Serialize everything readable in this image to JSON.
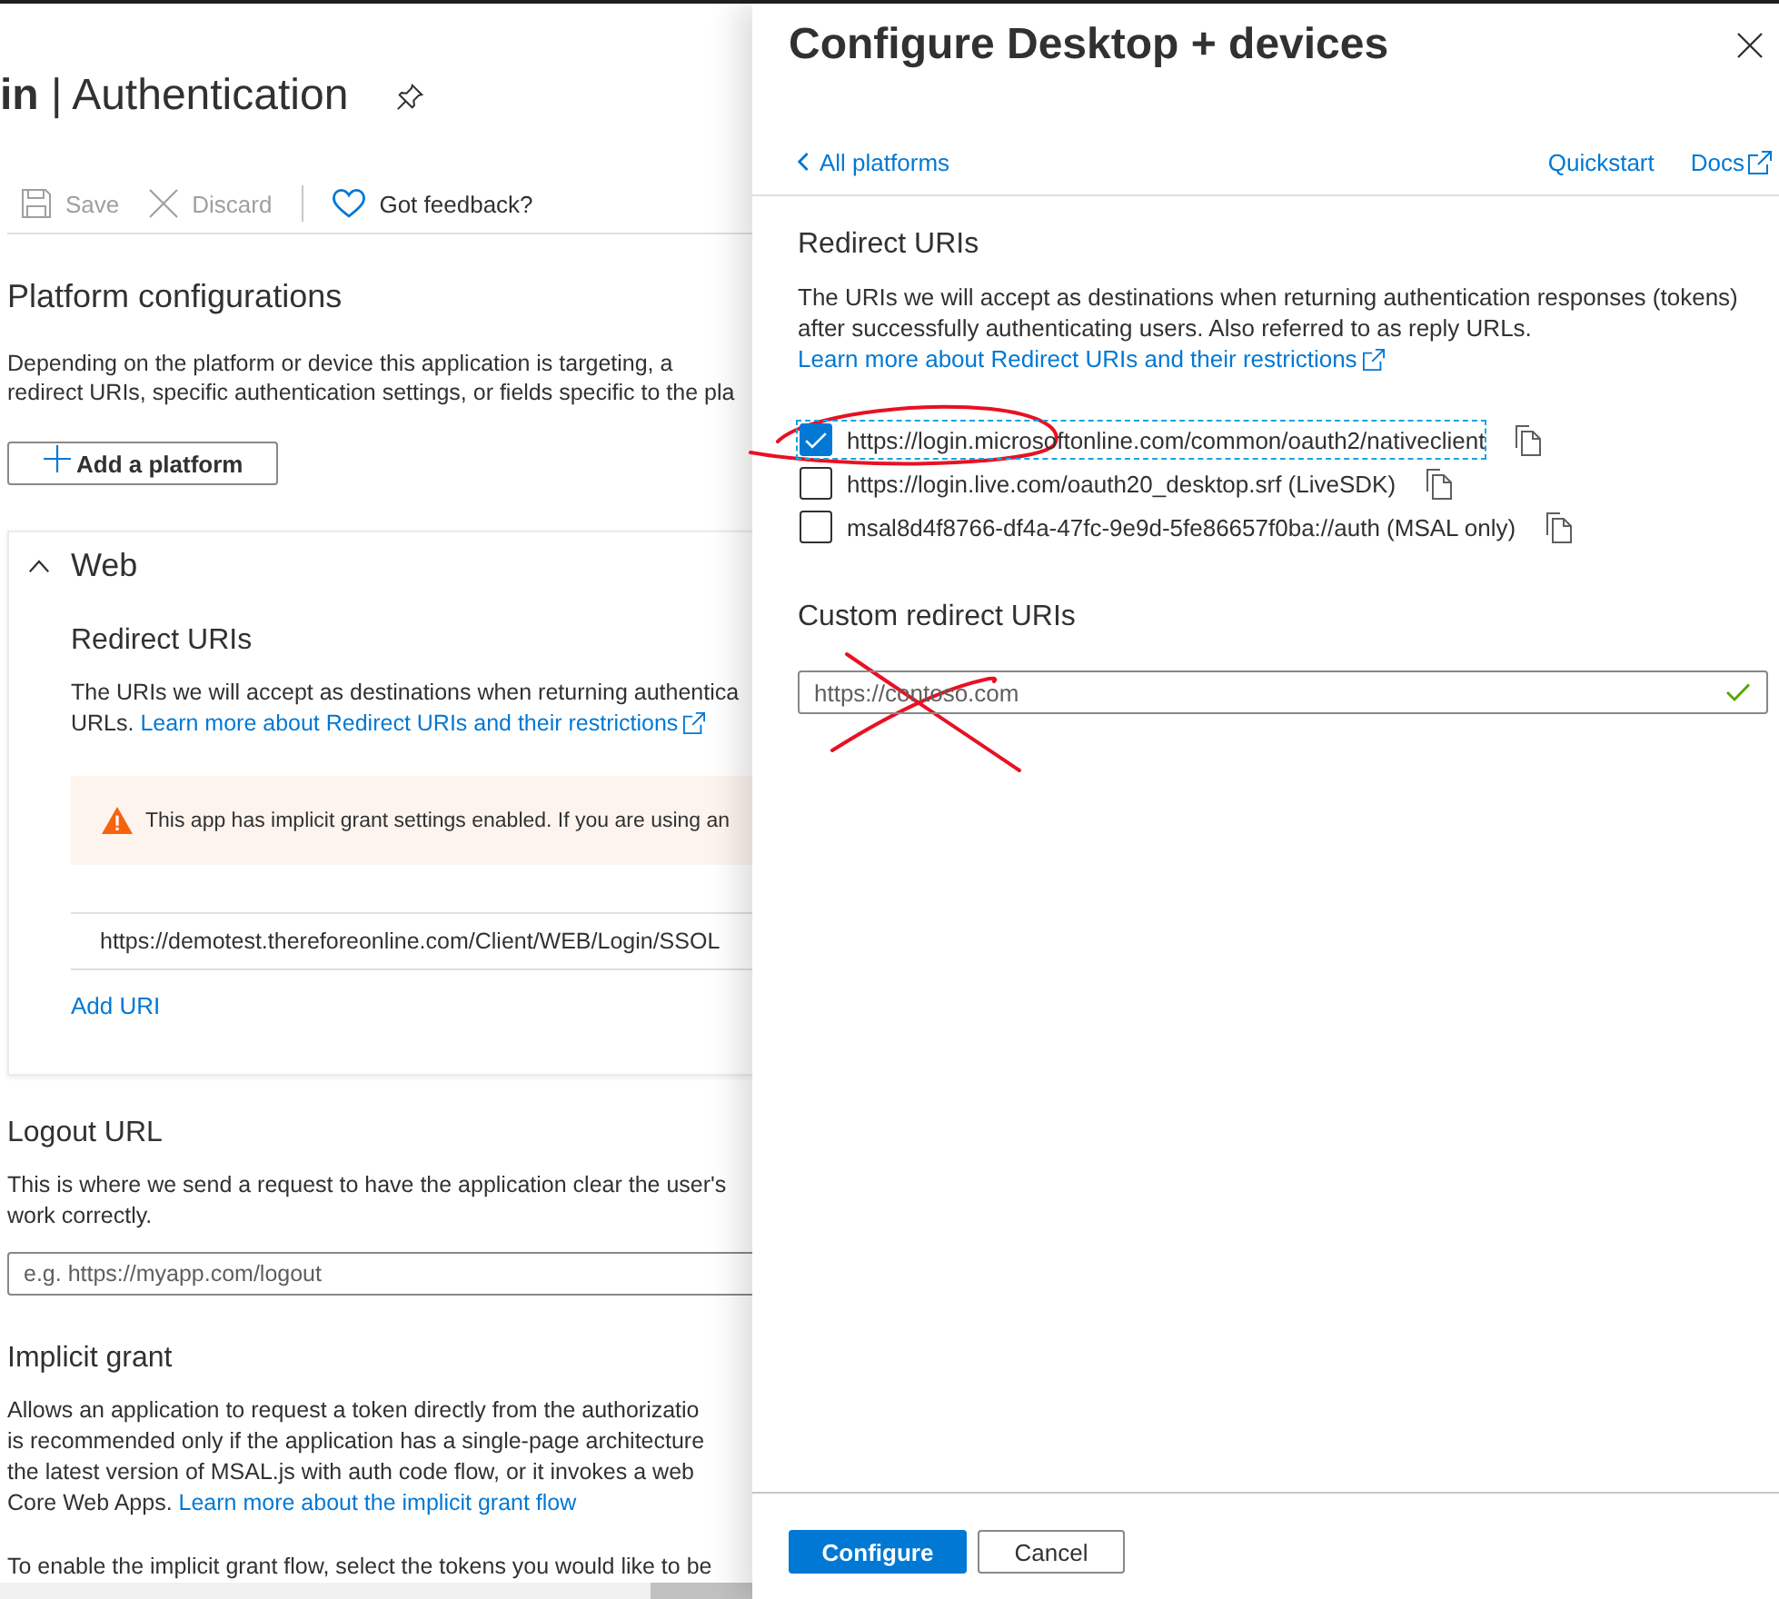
{
  "page": {
    "title": "**in** | Authentication",
    "toolbar": {
      "save": {
        "label": "Save",
        "disabled": true
      },
      "discard": {
        "label": "Discard",
        "disabled": true
      },
      "feedback": {
        "label": "Got feedback?",
        "disabled": false
      }
    },
    "platforms": {
      "heading": "Platform configurations",
      "lines": [
        "Depending on the platform or device this application is targeting, a",
        "redirect URIs, specific authentication settings, or fields specific to the pla"
      ],
      "add_button": "Add a platform"
    },
    "web_card": {
      "title": "Web",
      "expanded": true,
      "heading": "Redirect URIs",
      "lines": [
        "The URIs we will accept as destinations when returning authentica",
        "URLs."
      ],
      "link": "Learn more about Redirect URIs and their restrictions",
      "warning": "This app has implicit grant settings enabled. If you are using an",
      "uris": [
        "https://demotest.thereforeonline.com/Client/WEB/Login/SSOL"
      ],
      "add_uri": "Add URI"
    },
    "logout": {
      "heading": "Logout URL",
      "lines": [
        "This is where we send a request to have the application clear the user's",
        "work correctly."
      ],
      "placeholder": "e.g. https://myapp.com/logout"
    },
    "implicit_grant": {
      "heading": "Implicit grant",
      "lines": [
        "Allows an application to request a token directly from the authorizatio",
        "is recommended only if the application has a single-page architecture",
        "the latest version of MSAL.js with auth code flow, or it invokes a web",
        "Core Web Apps."
      ],
      "link": "Learn more about the implicit grant flow",
      "note": "To enable the implicit grant flow, select the tokens you would like to be"
    }
  },
  "panel": {
    "title": "Configure Desktop + devices",
    "back_link": "All platforms",
    "quickstart": "Quickstart",
    "docs": "Docs",
    "redirect": {
      "heading": "Redirect URIs",
      "description": "The URIs we will accept as destinations when returning authentication responses (tokens) after successfully authenticating users. Also referred to as reply URLs.",
      "link": "Learn more about Redirect URIs and their restrictions",
      "options": [
        {
          "uri": "https://login.microsoftonline.com/common/oauth2/nativeclient",
          "checked": true,
          "focused": true,
          "circled": true
        },
        {
          "uri": "https://login.live.com/oauth20_desktop.srf (LiveSDK)",
          "checked": false,
          "focused": false,
          "circled": false
        },
        {
          "uri": "msal8d4f8766-df4a-47fc-9e9d-5fe86657f0ba://auth (MSAL only)",
          "checked": false,
          "focused": false,
          "circled": false
        }
      ]
    },
    "custom": {
      "heading": "Custom redirect URIs",
      "value": "https://contoso.com",
      "valid": true,
      "crossed_out": true
    },
    "buttons": {
      "configure": "Configure",
      "cancel": "Cancel"
    }
  }
}
